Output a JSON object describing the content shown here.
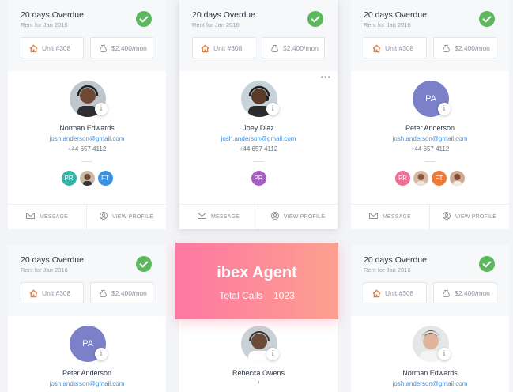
{
  "cards": [
    {
      "overdue": "20 days Overdue",
      "rent": "Rent for Jan 2016",
      "unit": "Unit #308",
      "price": "$2,400/mon",
      "name": "Norman Edwards",
      "email": "josh.anderson@gmail.com",
      "phone": "+44 657 4112",
      "team": [
        {
          "initials": "PR",
          "color": "#36b3a8"
        },
        {
          "initials": "",
          "color": "#c9b8a6"
        },
        {
          "initials": "FT",
          "color": "#3d8fe0"
        }
      ],
      "message": "MESSAGE",
      "view": "VIEW PROFILE"
    },
    {
      "overdue": "20 days Overdue",
      "rent": "Rent for Jan 2016",
      "unit": "Unit #308",
      "price": "$2,400/mon",
      "name": "Joey Diaz",
      "email": "josh.anderson@gmail.com",
      "phone": "+44 657 4112",
      "team": [
        {
          "initials": "PR",
          "color": "#a65cc3"
        }
      ],
      "message": "MESSAGE",
      "view": "VIEW PROFILE",
      "more": "•••"
    },
    {
      "overdue": "20 days Overdue",
      "rent": "Rent for Jan 2016",
      "unit": "Unit #308",
      "price": "$2,400/mon",
      "avatar_initials": "PA",
      "name": "Peter Anderson",
      "email": "josh.anderson@gmail.com",
      "phone": "+44 657 4112",
      "team": [
        {
          "initials": "PR",
          "color": "#f06d94"
        },
        {
          "initials": "",
          "color": "#d9b9a6"
        },
        {
          "initials": "FT",
          "color": "#f07a3a"
        },
        {
          "initials": "",
          "color": "#cfa98e"
        }
      ],
      "message": "MESSAGE",
      "view": "VIEW PROFILE"
    },
    {
      "overdue": "20 days Overdue",
      "rent": "Rent for Jan 2016",
      "unit": "Unit #308",
      "price": "$2,400/mon",
      "avatar_initials": "PA",
      "name": "Peter Anderson",
      "email": "josh.anderson@gmail.com"
    },
    {
      "name": "Rebecca Owens",
      "email": "/"
    },
    {
      "overdue": "20 days Overdue",
      "rent": "Rent for Jan 2016",
      "unit": "Unit #308",
      "price": "$2,400/mon",
      "name": "Norman Edwards",
      "email": "josh.anderson@gmail.com"
    }
  ],
  "banner": {
    "title": "ibex Agent",
    "calls_label": "Total Calls",
    "calls_value": "1023"
  },
  "colors": {
    "check": "#5cb85c",
    "email": "#3d8fe0",
    "pa_avatar": "#7b80c9",
    "banner_start": "#fd77a2",
    "banner_end": "#fda08f",
    "home_icon": "#f07a3a"
  }
}
